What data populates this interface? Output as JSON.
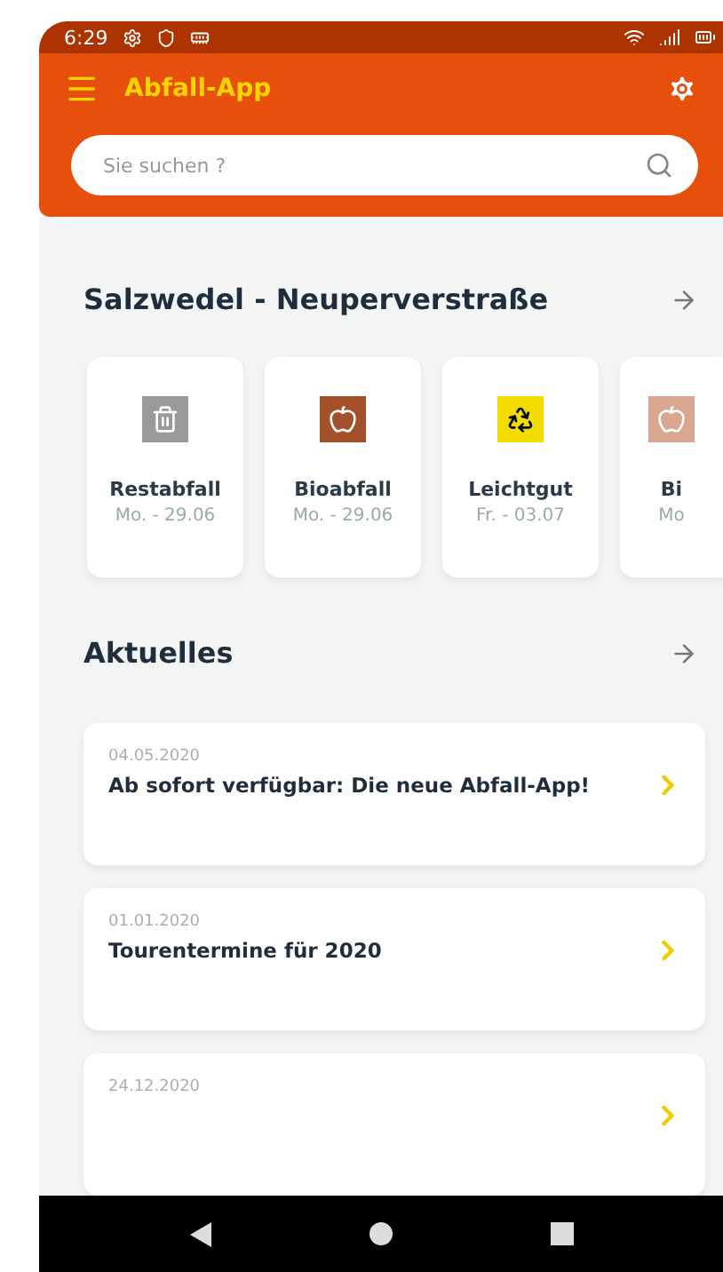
{
  "status_bar": {
    "time": "6:29"
  },
  "app_bar": {
    "title": "Abfall-App"
  },
  "search": {
    "placeholder": "Sie suchen ?"
  },
  "location": {
    "title": "Salzwedel - Neuperverstraße"
  },
  "waste_types": [
    {
      "kind": "rest",
      "name": "Restabfall",
      "date": "Mo. - 29.06",
      "color": "#9a9a9a"
    },
    {
      "kind": "bio",
      "name": "Bioabfall",
      "date": "Mo. - 29.06",
      "color": "#a4502a"
    },
    {
      "kind": "recycle",
      "name": "Leichtgut",
      "date": "Fr. - 03.07",
      "color": "#f2dc00"
    },
    {
      "kind": "bio",
      "name": "Bi",
      "date": "Mo",
      "color": "#d9a78f"
    }
  ],
  "news_section": {
    "title": "Aktuelles"
  },
  "news": [
    {
      "date": "04.05.2020",
      "title": "Ab sofort verfügbar: Die neue Abfall-App!"
    },
    {
      "date": "01.01.2020",
      "title": "Tourentermine für 2020"
    },
    {
      "date": "24.12.2020"
    }
  ]
}
